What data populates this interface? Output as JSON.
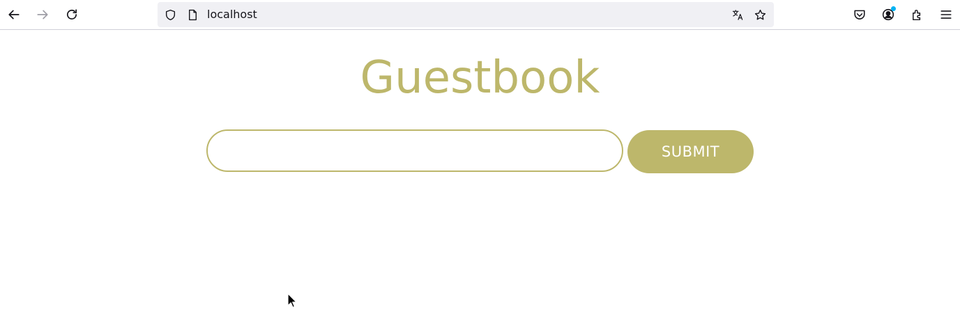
{
  "browser": {
    "url": "localhost",
    "icons": {
      "back": "arrow-left-icon",
      "forward": "arrow-right-icon",
      "reload": "reload-icon",
      "tracking": "shield-icon",
      "page": "page-icon",
      "translate": "translate-icon",
      "bookmark": "star-icon",
      "pocket": "pocket-icon",
      "account": "account-icon",
      "extensions": "puzzle-icon",
      "menu": "hamburger-menu-icon"
    },
    "accent_color": "#00b3f4"
  },
  "page": {
    "title": "Guestbook",
    "entry_value": "",
    "submit_label": "SUBMIT",
    "accent_color": "#bdb76b"
  }
}
